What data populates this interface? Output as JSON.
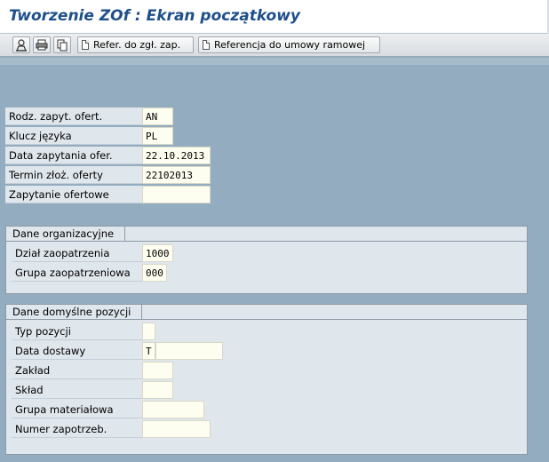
{
  "window": {
    "title": "Tworzenie ZOf : Ekran początkowy"
  },
  "toolbar": {
    "icon_buttons": [
      "organization-icon",
      "print-icon",
      "copy-icon"
    ],
    "ref_quote_label": "Refer. do zgł. zap.",
    "ref_contract_label": "Referencja do umowy ramowej"
  },
  "header_fields": {
    "rfq_type": {
      "label": "Rodz. zapyt. ofert.",
      "value": "AN"
    },
    "language_key": {
      "label": "Klucz języka",
      "value": "PL"
    },
    "rfq_date": {
      "label": "Data zapytania ofer.",
      "value": "22.10.2013"
    },
    "quote_deadline": {
      "label": "Termin złoż. oferty",
      "value": "22102013"
    },
    "rfq_number": {
      "label": "Zapytanie ofertowe",
      "value": ""
    }
  },
  "org_data": {
    "title": "Dane organizacyjne",
    "purchasing_org": {
      "label": "Dział zaopatrzenia",
      "value": "1000"
    },
    "purchasing_group": {
      "label": "Grupa zaopatrzeniowa",
      "value": "000"
    }
  },
  "item_defaults": {
    "title": "Dane domyślne pozycji",
    "item_category": {
      "label": "Typ pozycji",
      "value": ""
    },
    "delivery_date": {
      "label": "Data dostawy",
      "value": "T",
      "value2": ""
    },
    "plant": {
      "label": "Zakład",
      "value": ""
    },
    "storage_location": {
      "label": "Skład",
      "value": ""
    },
    "material_group": {
      "label": "Grupa materiałowa",
      "value": ""
    },
    "requirement_tracking": {
      "label": "Numer zapotrzeb.",
      "value": ""
    }
  }
}
